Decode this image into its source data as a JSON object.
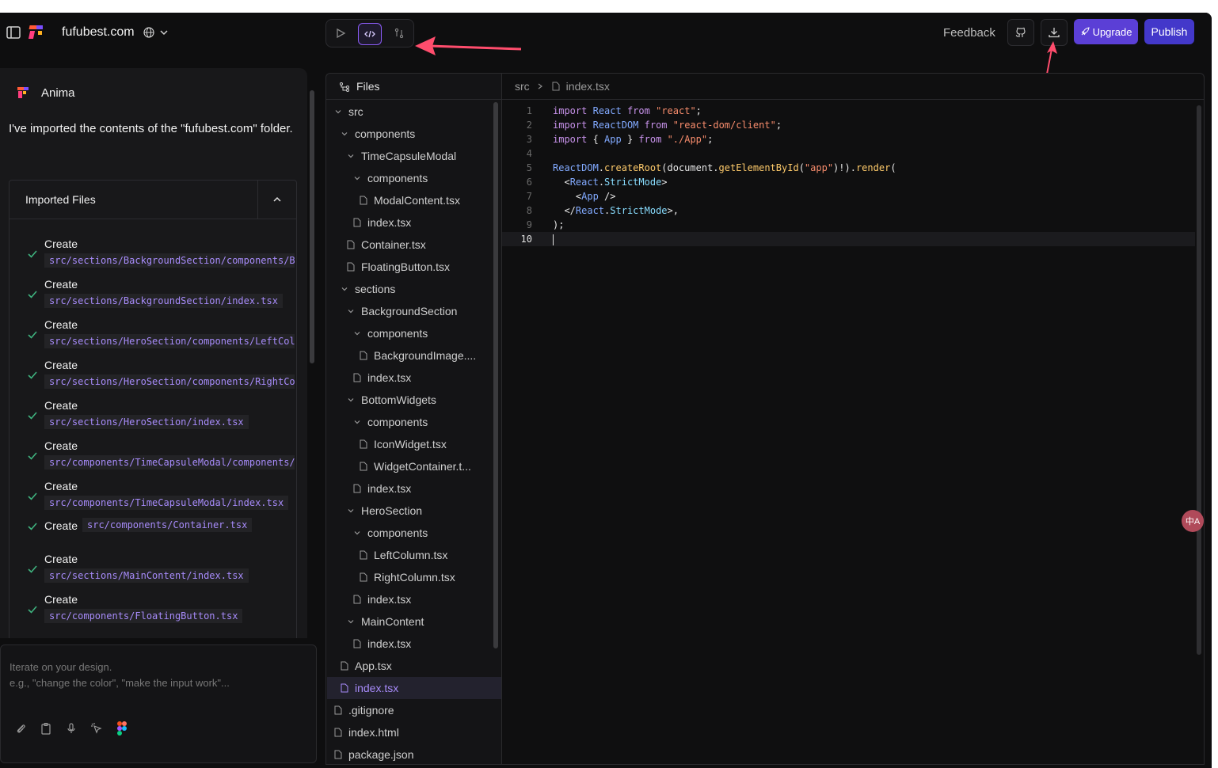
{
  "topbar": {
    "project_name": "fufubest.com",
    "feedback": "Feedback",
    "upgrade": "Upgrade",
    "publish": "Publish"
  },
  "chat": {
    "agent_name": "Anima",
    "message": "I've imported the contents of the \"fufubest.com\" folder.",
    "imported_title": "Imported Files",
    "items": [
      {
        "label": "Create",
        "path": "src/sections/BackgroundSection/components/BackgroundImage.tsx"
      },
      {
        "label": "Create",
        "path": "src/sections/BackgroundSection/index.tsx"
      },
      {
        "label": "Create",
        "path": "src/sections/HeroSection/components/LeftColumn.tsx"
      },
      {
        "label": "Create",
        "path": "src/sections/HeroSection/components/RightColumn.tsx"
      },
      {
        "label": "Create",
        "path": "src/sections/HeroSection/index.tsx"
      },
      {
        "label": "Create",
        "path": "src/components/TimeCapsuleModal/components/ModalContent.tsx"
      },
      {
        "label": "Create",
        "path": "src/components/TimeCapsuleModal/index.tsx"
      },
      {
        "label": "Create",
        "path": "src/components/Container.tsx"
      },
      {
        "label": "Create",
        "path": "src/sections/MainContent/index.tsx"
      },
      {
        "label": "Create",
        "path": "src/components/FloatingButton.tsx"
      }
    ],
    "input_placeholder_1": "Iterate on your design.",
    "input_placeholder_2": "e.g., \"change the color\", \"make the input work\"..."
  },
  "explorer": {
    "title": "Files",
    "tree": [
      {
        "label": "src",
        "type": "folder"
      },
      {
        "label": "components",
        "type": "folder"
      },
      {
        "label": "TimeCapsuleModal",
        "type": "folder"
      },
      {
        "label": "components",
        "type": "folder"
      },
      {
        "label": "ModalContent.tsx",
        "type": "file"
      },
      {
        "label": "index.tsx",
        "type": "file"
      },
      {
        "label": "Container.tsx",
        "type": "file"
      },
      {
        "label": "FloatingButton.tsx",
        "type": "file"
      },
      {
        "label": "sections",
        "type": "folder"
      },
      {
        "label": "BackgroundSection",
        "type": "folder"
      },
      {
        "label": "components",
        "type": "folder"
      },
      {
        "label": "BackgroundImage....",
        "type": "file"
      },
      {
        "label": "index.tsx",
        "type": "file"
      },
      {
        "label": "BottomWidgets",
        "type": "folder"
      },
      {
        "label": "components",
        "type": "folder"
      },
      {
        "label": "IconWidget.tsx",
        "type": "file"
      },
      {
        "label": "WidgetContainer.t...",
        "type": "file"
      },
      {
        "label": "index.tsx",
        "type": "file"
      },
      {
        "label": "HeroSection",
        "type": "folder"
      },
      {
        "label": "components",
        "type": "folder"
      },
      {
        "label": "LeftColumn.tsx",
        "type": "file"
      },
      {
        "label": "RightColumn.tsx",
        "type": "file"
      },
      {
        "label": "index.tsx",
        "type": "file"
      },
      {
        "label": "MainContent",
        "type": "folder"
      },
      {
        "label": "index.tsx",
        "type": "file"
      },
      {
        "label": "App.tsx",
        "type": "file"
      },
      {
        "label": "index.tsx",
        "type": "file",
        "selected": true
      },
      {
        "label": ".gitignore",
        "type": "file"
      },
      {
        "label": "index.html",
        "type": "file"
      },
      {
        "label": "package.json",
        "type": "file"
      }
    ]
  },
  "editor": {
    "breadcrumb_folder": "src",
    "breadcrumb_file": "index.tsx",
    "line_numbers": [
      "1",
      "2",
      "3",
      "4",
      "5",
      "6",
      "7",
      "8",
      "9",
      "10"
    ],
    "lines": [
      "import React from \"react\";",
      "import ReactDOM from \"react-dom/client\";",
      "import { App } from \"./App\";",
      "",
      "ReactDOM.createRoot(document.getElementById(\"app\")!).render(",
      "  <React.StrictMode>",
      "    <App />",
      "  </React.StrictMode>,",
      ");",
      ""
    ]
  },
  "colors": {
    "accent": "#8b5cf6",
    "upgrade_bg": "#5b3fd6",
    "publish_bg": "#4338ca",
    "annotation_arrow": "#ff4d6d"
  }
}
